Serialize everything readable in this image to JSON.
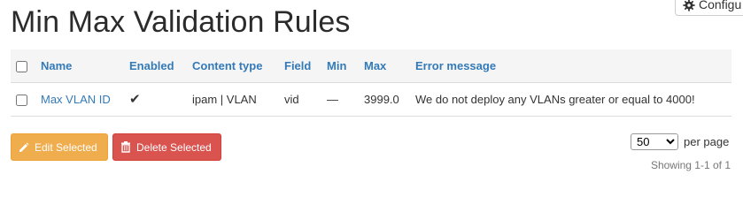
{
  "page": {
    "title": "Min Max Validation Rules"
  },
  "toolbar": {
    "configure_label": "Configu"
  },
  "table": {
    "columns": [
      "Name",
      "Enabled",
      "Content type",
      "Field",
      "Min",
      "Max",
      "Error message"
    ],
    "rows": [
      {
        "name": "Max VLAN ID",
        "enabled": "✔",
        "content_type": "ipam | VLAN",
        "field": "vid",
        "min": "—",
        "max": "3999.0",
        "error_message": "We do not deploy any VLANs greater or equal to 4000!"
      }
    ]
  },
  "actions": {
    "edit_label": "Edit Selected",
    "delete_label": "Delete Selected"
  },
  "pagination": {
    "per_page_value": "50",
    "per_page_label": "per page",
    "showing": "Showing 1-1 of 1"
  },
  "colors": {
    "link": "#337ab7",
    "edit": "#f0ad4e",
    "delete": "#d9534f"
  },
  "icons": {
    "configure": "gear-icon",
    "edit": "pencil-icon",
    "delete": "trash-icon"
  }
}
